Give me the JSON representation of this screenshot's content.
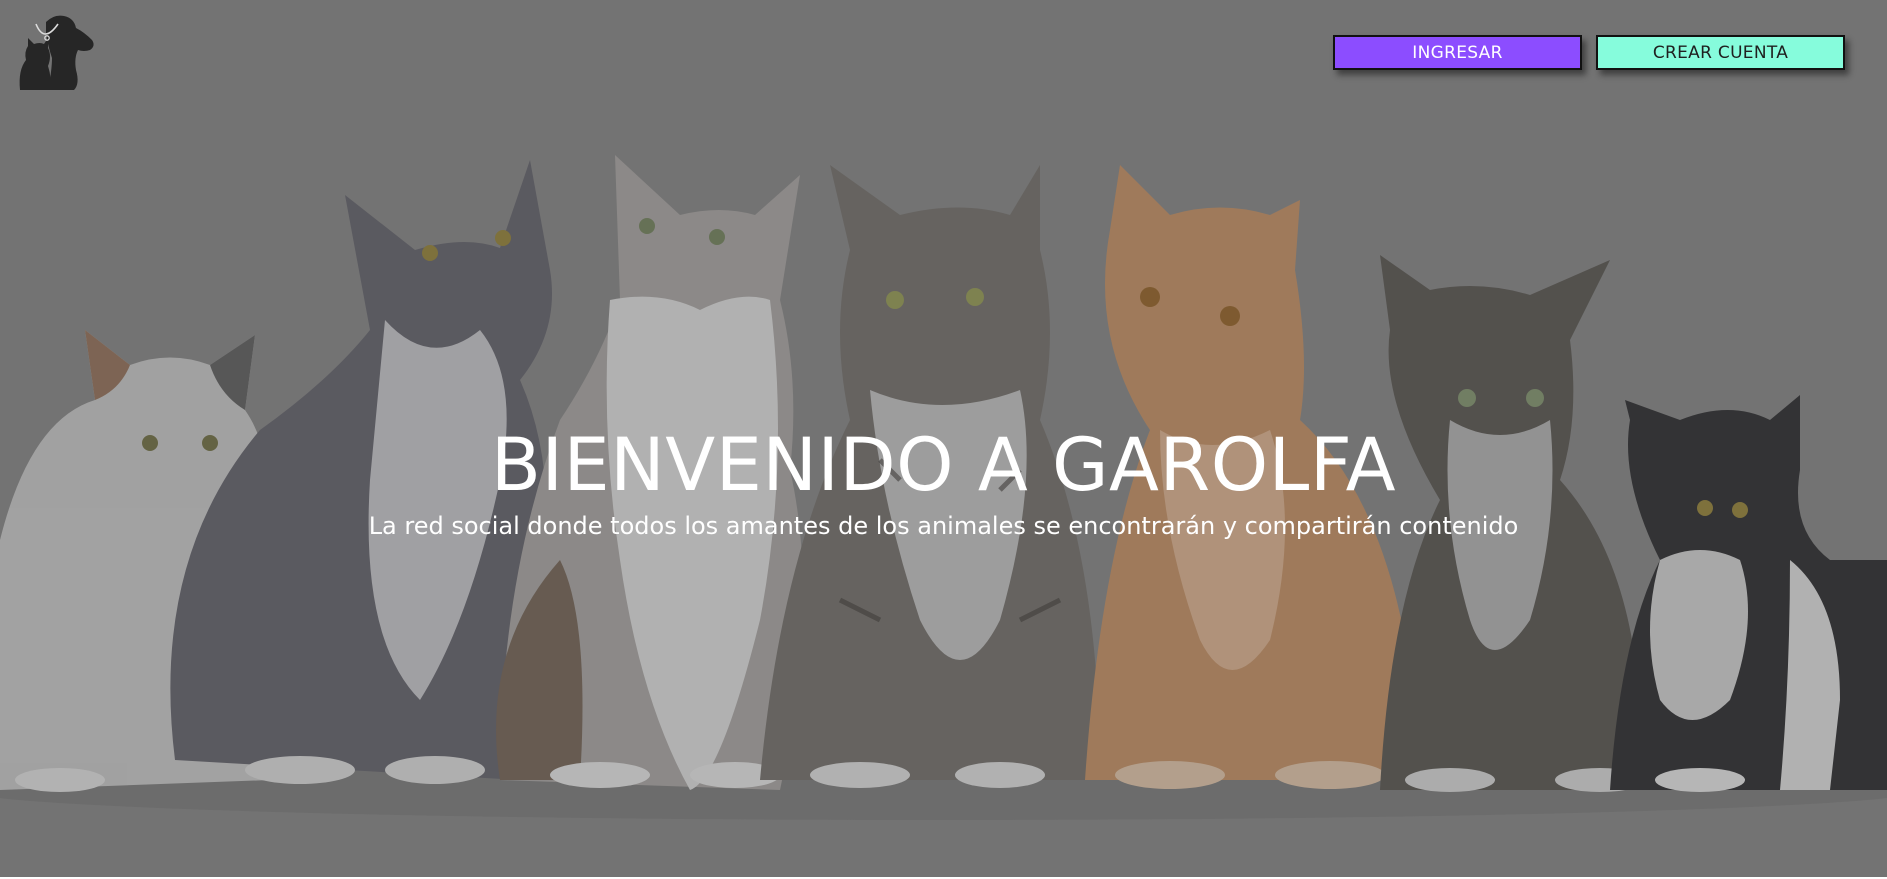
{
  "header": {
    "logo_icon": "dog-and-cat-silhouette-icon",
    "login_label": "INGRESAR",
    "signup_label": "CREAR CUENTA"
  },
  "hero": {
    "background_image": "row-of-kittens-photo",
    "title": "BIENVENIDO A GAROLFA",
    "subtitle": "La red social donde todos los amantes de los animales se encontrarán y compartirán contenido"
  },
  "colors": {
    "login_button": "#8c4dff",
    "signup_button": "#86fcdc",
    "hero_tint": "#7d7d7d",
    "text": "#ffffff"
  }
}
